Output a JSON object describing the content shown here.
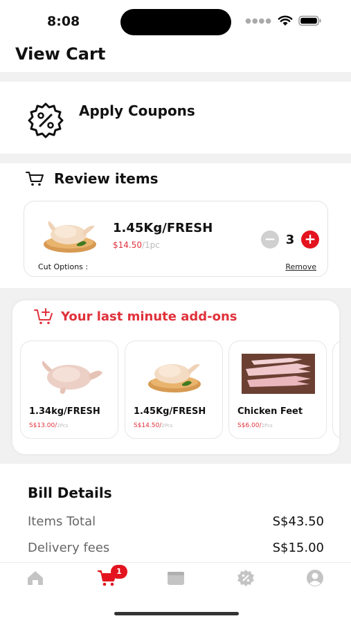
{
  "status": {
    "time": "8:08"
  },
  "page": {
    "title": "View Cart"
  },
  "coupons": {
    "label": "Apply Coupons"
  },
  "review": {
    "title": "Review items",
    "item": {
      "name": "1.45Kg/FRESH",
      "price": "$14.50",
      "unit": "/1pc",
      "quantity": "3",
      "cut_options_label": "Cut Options :",
      "remove_label": "Remove"
    }
  },
  "addons": {
    "title": "Your last minute add-ons",
    "items": [
      {
        "name": "1.34kg/FRESH",
        "price": "S$13.00/",
        "unit": "2Pcs"
      },
      {
        "name": "1.45Kg/FRESH",
        "price": "S$14.50/",
        "unit": "2Pcs"
      },
      {
        "name": "Chicken Feet",
        "price": "S$6.00/",
        "unit": "2Pcs"
      }
    ]
  },
  "bill": {
    "title": "Bill Details",
    "rows": [
      {
        "label": "Items Total",
        "value": "S$43.50"
      },
      {
        "label": "Delivery fees",
        "value": "S$15.00"
      }
    ]
  },
  "tabbar": {
    "cart_badge": "1",
    "tabs": [
      "home-icon",
      "cart-icon",
      "orders-icon",
      "offers-icon",
      "profile-icon"
    ]
  },
  "colors": {
    "accent": "#e3141f",
    "price": "#e0313b",
    "inactive": "#c4c4c4"
  }
}
